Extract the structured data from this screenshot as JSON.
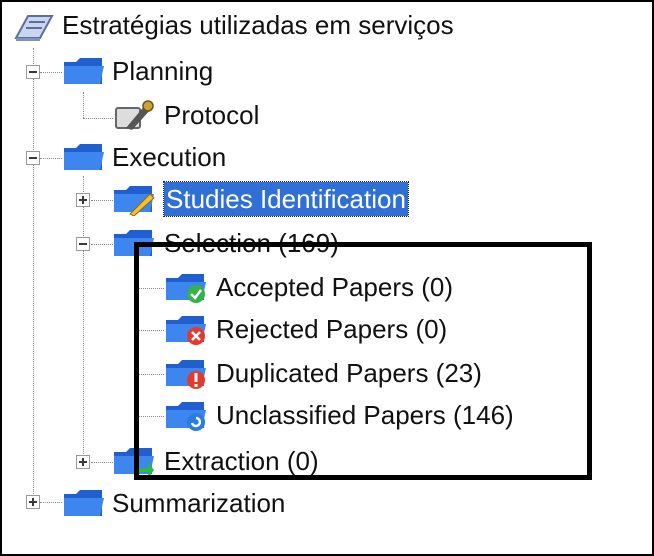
{
  "tree": {
    "root": {
      "label": "Estratégias utilizadas em serviços",
      "icon": "root-book-icon"
    },
    "planning": {
      "label": "Planning",
      "icon": "folder-icon",
      "expanded": true,
      "children": [
        {
          "label": "Protocol",
          "icon": "protocol-wrench-icon"
        }
      ]
    },
    "execution": {
      "label": "Execution",
      "icon": "folder-icon",
      "expanded": true,
      "studies_identification": {
        "label": "Studies Identification",
        "icon": "folder-pencil-icon",
        "selected": true
      },
      "selection": {
        "label": "Selection (169)",
        "icon": "folder-icon",
        "expanded": true,
        "children": [
          {
            "label": "Accepted Papers (0)",
            "icon": "folder-check-icon"
          },
          {
            "label": "Rejected Papers (0)",
            "icon": "folder-reject-icon"
          },
          {
            "label": "Duplicated Papers (23)",
            "icon": "folder-duplicate-icon"
          },
          {
            "label": "Unclassified Papers (146)",
            "icon": "folder-unclassified-icon"
          }
        ]
      },
      "extraction": {
        "label": "Extraction (0)",
        "icon": "folder-extraction-icon"
      }
    },
    "summarization": {
      "label": "Summarization",
      "icon": "folder-icon"
    }
  },
  "colors": {
    "selection_bg": "#2f6fd6",
    "folder_blue": "#1f5fcf",
    "highlight_border": "#000000"
  }
}
